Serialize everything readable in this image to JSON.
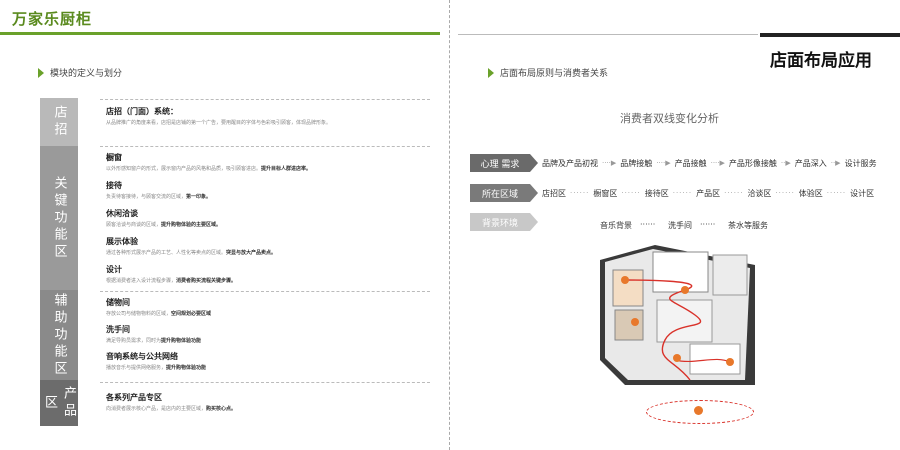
{
  "brand": "万家乐厨柜",
  "page_title": "店面布局应用",
  "left": {
    "section": "模块的定义与划分",
    "categories": [
      "店招",
      "关键功能区",
      "辅助功能区",
      "产品区"
    ],
    "rows": [
      {
        "title": "店招（门面）系统：",
        "desc": "从品牌推广的角度来看，店招是店铺的第一个广告，要用醒目的字体与色彩吸引顾客，体现品牌形象。"
      },
      {
        "title": "橱窗",
        "desc": "以外形感知窗户的形式，展示窗内产品的风格和品质，吸引顾客进店。",
        "strong": "提升目标人群进店率。"
      },
      {
        "title": "接待",
        "desc": "负责待客接待，与顾客交流的区域，",
        "strong": "第一印象。"
      },
      {
        "title": "休闲洽谈",
        "desc": "顾客洽谈与商谈的区域，",
        "strong": "提升购物体验的主要区域。"
      },
      {
        "title": "展示体验",
        "desc": "通过各种形式展示产品的工艺、人性化等卖点的区域。",
        "strong": "突显与放大产品卖点。"
      },
      {
        "title": "设计",
        "desc": "根据消费者进入设计流程步骤，",
        "strong": "消费者购买流程关键步骤。"
      },
      {
        "title": "储物间",
        "desc": "存放公司与储物物料的区域，",
        "strong": "空间规划必要区域"
      },
      {
        "title": "洗手间",
        "desc": "满足导购员需求，同时为",
        "strong": "提升购物体验功能"
      },
      {
        "title": "音响系统与公共网络",
        "desc": "播放音乐与提供网络服务，",
        "strong": "提升购物体验功能"
      },
      {
        "title": "各系列产品专区",
        "desc": "向消费者展示核心产品，是店内的主要区域，",
        "strong": "购买核心点。"
      }
    ]
  },
  "right": {
    "section": "店面布局原则与消费者关系",
    "chart_title": "消费者双线变化分析",
    "row1": {
      "tag": "心理 需求",
      "items": [
        "品牌及产品初视",
        "品牌接触",
        "产品接触",
        "产品形像接触",
        "产品深入",
        "设计服务"
      ]
    },
    "row2": {
      "tag": "所在区域",
      "items": [
        "店招区",
        "橱窗区",
        "接待区",
        "产品区",
        "洽谈区",
        "体验区",
        "设计区"
      ]
    },
    "row3": {
      "tag": "背景环境",
      "items": [
        "音乐背景",
        "洗手间",
        "茶水等服务"
      ]
    },
    "colors": {
      "accent": "#6aa12a",
      "path": "#d9322a",
      "marker": "#e8782b"
    }
  }
}
